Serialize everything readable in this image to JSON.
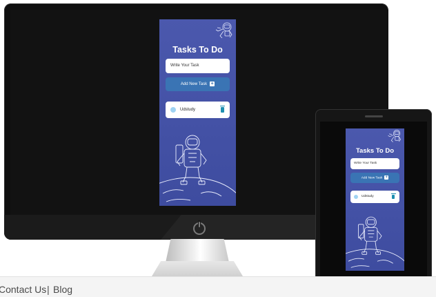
{
  "app": {
    "title": "Tasks To Do",
    "input_placeholder": "Write Your Task",
    "add_button_label": "Add New Task",
    "add_button_icon": "+",
    "task": {
      "label": "Udstudy"
    }
  },
  "footer": {
    "links": [
      "Contact Us",
      "Blog"
    ],
    "separator": "|"
  },
  "colors": {
    "app_background": "#4654a9",
    "add_button": "#3a74b4",
    "task_dot": "#9fd3f2",
    "trash": "#1f8fb0"
  }
}
